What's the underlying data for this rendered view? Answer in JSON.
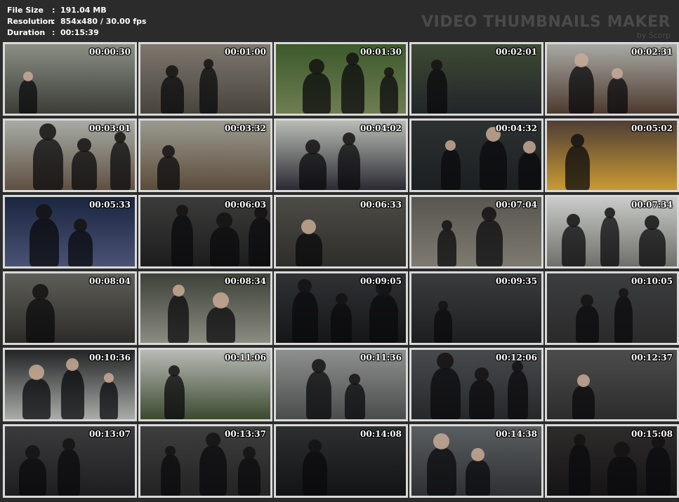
{
  "info": [
    {
      "key": "File Size",
      "value": "191.04 MB"
    },
    {
      "key": "Resolution",
      "value": "854x480 / 30.00 fps"
    },
    {
      "key": "Duration",
      "value": "00:15:39"
    }
  ],
  "info_separator": ":",
  "watermark": {
    "title": "VIDEO THUMBNAILS MAKER",
    "subtitle": "by Scorp"
  },
  "thumbnails": [
    {
      "time": "00:00:30",
      "bg": [
        "#8a8f85",
        "#3b3d36"
      ]
    },
    {
      "time": "00:01:00",
      "bg": [
        "#7d776e",
        "#48443c"
      ]
    },
    {
      "time": "00:01:30",
      "bg": [
        "#3c5a2c",
        "#6f7d52"
      ]
    },
    {
      "time": "00:02:01",
      "bg": [
        "#3e4a34",
        "#22252a"
      ]
    },
    {
      "time": "00:02:31",
      "bg": [
        "#a8a9a4",
        "#4d3a2e"
      ]
    },
    {
      "time": "00:03:01",
      "bg": [
        "#a7aba5",
        "#5f5040"
      ]
    },
    {
      "time": "00:03:32",
      "bg": [
        "#9b9a90",
        "#5b4c3a"
      ]
    },
    {
      "time": "00:04:02",
      "bg": [
        "#b8bcb4",
        "#2b2a33"
      ]
    },
    {
      "time": "00:04:32",
      "bg": [
        "#2c3131",
        "#1c1f22"
      ]
    },
    {
      "time": "00:05:02",
      "bg": [
        "#4e3e35",
        "#c99a34"
      ]
    },
    {
      "time": "00:05:33",
      "bg": [
        "#1b2640",
        "#4a5275"
      ]
    },
    {
      "time": "00:06:03",
      "bg": [
        "#3b3c3a",
        "#1c1d1d"
      ]
    },
    {
      "time": "00:06:33",
      "bg": [
        "#4c4b46",
        "#2f2e2a"
      ]
    },
    {
      "time": "00:07:04",
      "bg": [
        "#585650",
        "#7e7a70"
      ]
    },
    {
      "time": "00:07:34",
      "bg": [
        "#c9ccc8",
        "#6f6f6a"
      ]
    },
    {
      "time": "00:08:04",
      "bg": [
        "#5e5e58",
        "#2c2b28"
      ]
    },
    {
      "time": "00:08:34",
      "bg": [
        "#3d4138",
        "#8b8c80"
      ]
    },
    {
      "time": "00:09:05",
      "bg": [
        "#2f3134",
        "#151618"
      ]
    },
    {
      "time": "00:09:35",
      "bg": [
        "#3a3c3e",
        "#1d1e20"
      ]
    },
    {
      "time": "00:10:05",
      "bg": [
        "#3c3d3e",
        "#2a2a2b"
      ]
    },
    {
      "time": "00:10:36",
      "bg": [
        "#232426",
        "#a9aca8"
      ]
    },
    {
      "time": "00:11:06",
      "bg": [
        "#b8bab6",
        "#3c4a2f"
      ]
    },
    {
      "time": "00:11:36",
      "bg": [
        "#8d908d",
        "#4a4c4c"
      ]
    },
    {
      "time": "00:12:06",
      "bg": [
        "#474a4e",
        "#262729"
      ]
    },
    {
      "time": "00:12:37",
      "bg": [
        "#4c4c4c",
        "#2c2c2c"
      ]
    },
    {
      "time": "00:13:07",
      "bg": [
        "#3b3b3d",
        "#1e1e20"
      ]
    },
    {
      "time": "00:13:37",
      "bg": [
        "#3e3e3e",
        "#232323"
      ]
    },
    {
      "time": "00:14:08",
      "bg": [
        "#2d2f31",
        "#121314"
      ]
    },
    {
      "time": "00:14:38",
      "bg": [
        "#5a5e60",
        "#2e3033"
      ]
    },
    {
      "time": "00:15:08",
      "bg": [
        "#2e2b2b",
        "#151414"
      ]
    }
  ]
}
